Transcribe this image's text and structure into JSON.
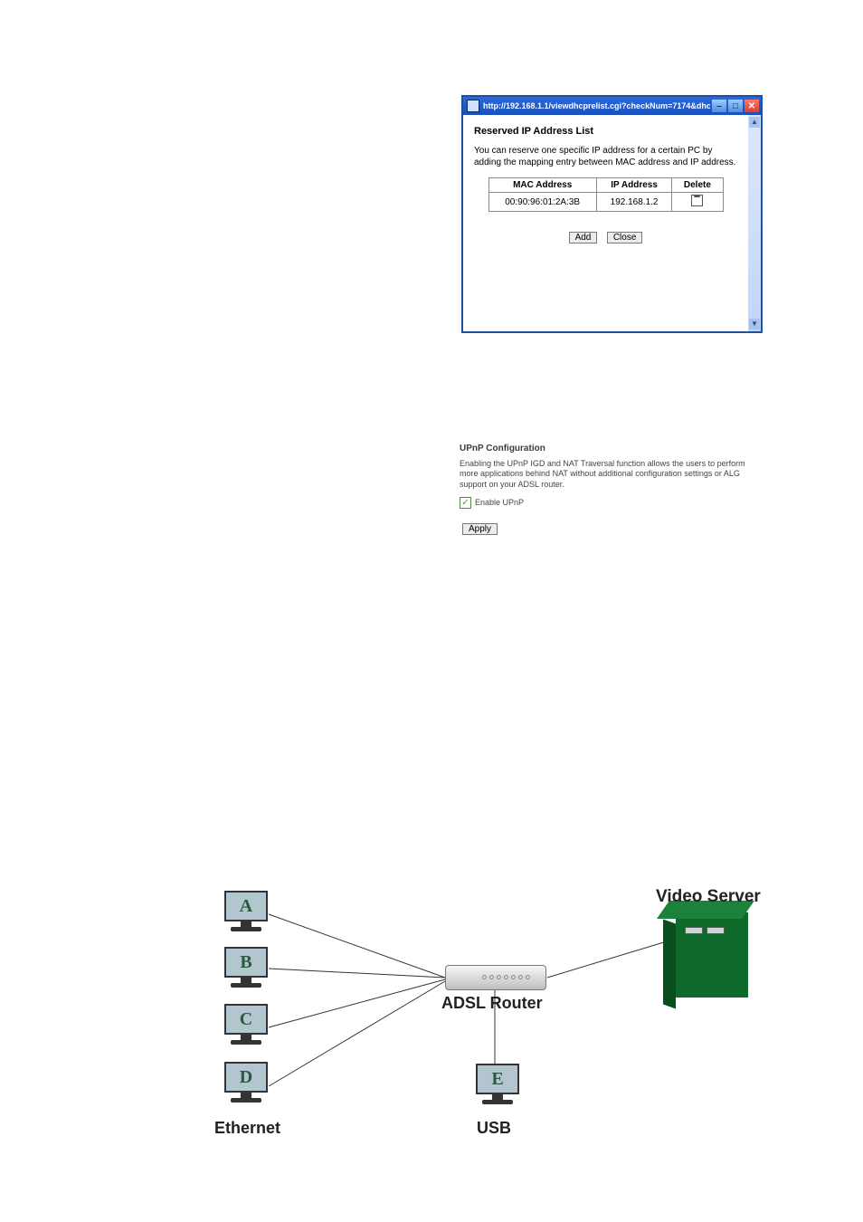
{
  "dialog": {
    "url": "http://192.168.1.1/viewdhcprelist.cgi?checkNum=7174&dhcpreli...",
    "heading": "Reserved IP Address List",
    "intro": "You can reserve one specific IP address for a certain PC by adding the mapping entry between MAC address and IP address.",
    "cols": {
      "mac": "MAC Address",
      "ip": "IP Address",
      "del": "Delete"
    },
    "rows": [
      {
        "mac": "00:90:96:01:2A:3B",
        "ip": "192.168.1.2"
      }
    ],
    "btn_add": "Add",
    "btn_close": "Close"
  },
  "upnp": {
    "title": "UPnP Configuration",
    "desc": "Enabling the UPnP IGD and NAT Traversal function allows the users to perform more applications behind NAT without additional configuration settings or ALG support on your ADSL router.",
    "chk_label": "Enable UPnP",
    "chk_checked": true,
    "btn_apply": "Apply"
  },
  "diagram": {
    "pcs": [
      "A",
      "B",
      "C",
      "D",
      "E"
    ],
    "router_label": "ADSL Router",
    "server_label": "Video Server",
    "eth_label": "Ethernet",
    "usb_label": "USB"
  }
}
